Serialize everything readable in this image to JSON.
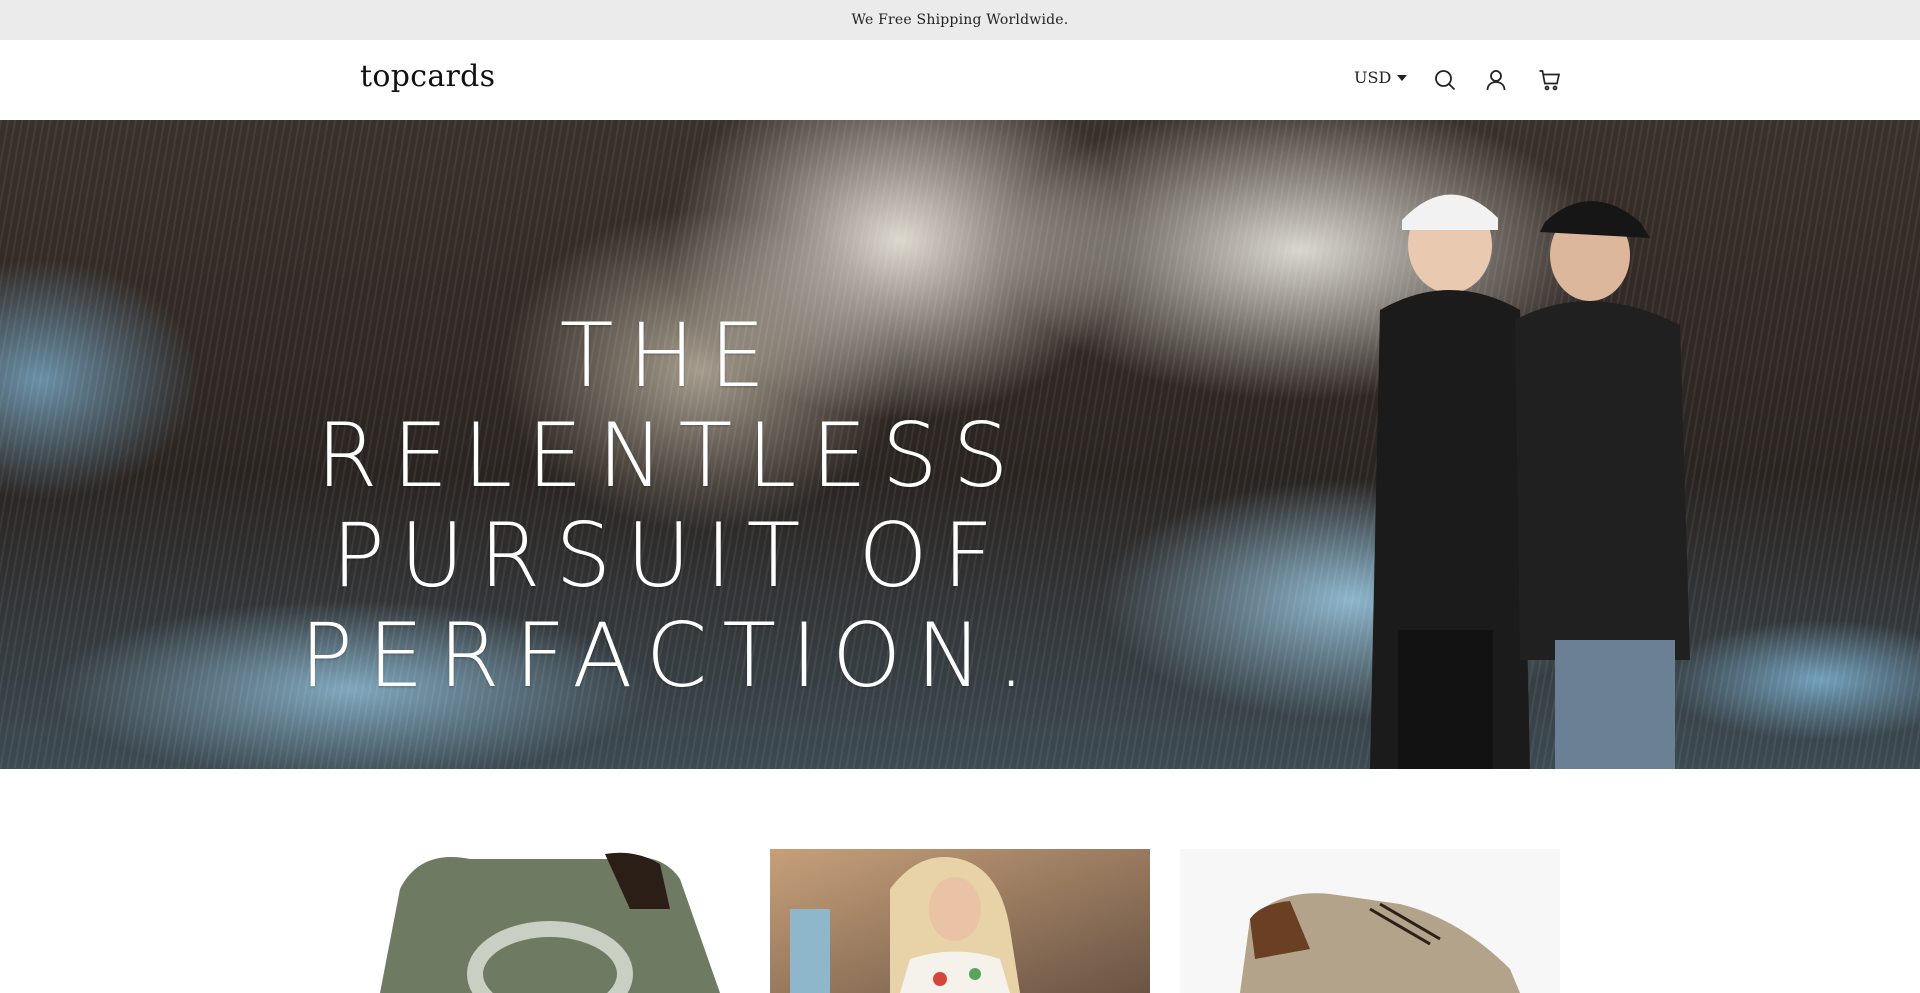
{
  "announcement": {
    "text": "We Free Shipping Worldwide."
  },
  "header": {
    "logo": "topcards",
    "currency": "USD",
    "icons": [
      "search-icon",
      "account-icon",
      "cart-icon"
    ]
  },
  "hero": {
    "title_lines": [
      "THE RELENTLESS",
      "PURSUIT OF",
      "PERFACTION."
    ]
  },
  "collection": {
    "cards": [
      {
        "name": "green-sherpa-jacket"
      },
      {
        "name": "woman-in-print-dress"
      },
      {
        "name": "suede-shoes"
      }
    ]
  },
  "colors": {
    "announcement_bg": "#ebebeb",
    "header_bg": "#ffffff",
    "hero_text": "#ffffff"
  }
}
